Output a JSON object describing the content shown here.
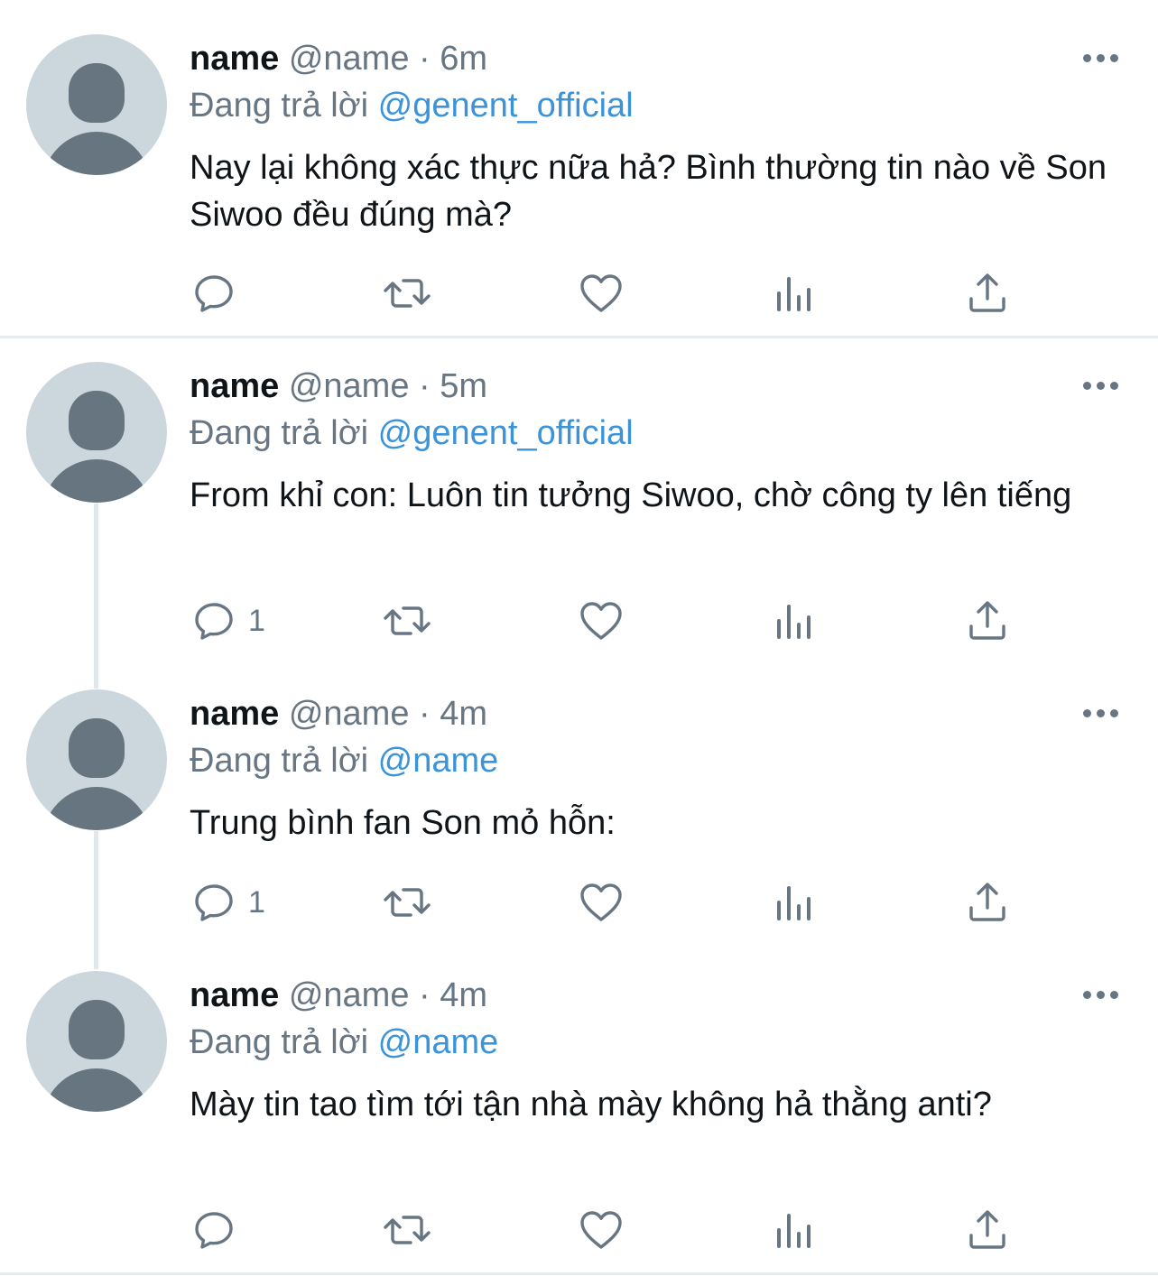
{
  "tweets": [
    {
      "name": "name",
      "handle": "@name",
      "separator": "·",
      "time": "6m",
      "reply_prefix": "Đang trả lời",
      "reply_to": "@genent_official",
      "text": "Nay lại không xác thực nữa hả? Bình thường tin nào về Son Siwoo đều đúng mà?",
      "reply_count": ""
    },
    {
      "name": "name",
      "handle": "@name",
      "separator": "·",
      "time": "5m",
      "reply_prefix": "Đang trả lời",
      "reply_to": "@genent_official",
      "text": "From khỉ con: Luôn tin tưởng Siwoo, chờ công ty lên tiếng",
      "reply_count": "1"
    },
    {
      "name": "name",
      "handle": "@name",
      "separator": "·",
      "time": "4m",
      "reply_prefix": "Đang trả lời",
      "reply_to": "@name",
      "text": "Trung bình fan Son mỏ hỗn:",
      "reply_count": "1"
    },
    {
      "name": "name",
      "handle": "@name",
      "separator": "·",
      "time": "4m",
      "reply_prefix": "Đang trả lời",
      "reply_to": "@name",
      "text": "Mày tin tao tìm tới tận nhà mày không hả thằng anti?",
      "reply_count": ""
    }
  ],
  "icons": {
    "reply": "reply-icon",
    "retweet": "retweet-icon",
    "like": "heart-icon",
    "analytics": "analytics-icon",
    "share": "share-icon",
    "more": "more-icon"
  },
  "colors": {
    "mention": "#3b94d9",
    "secondary_text": "#687684",
    "avatar_bg": "#ccd6dd",
    "avatar_fg": "#66757f"
  }
}
